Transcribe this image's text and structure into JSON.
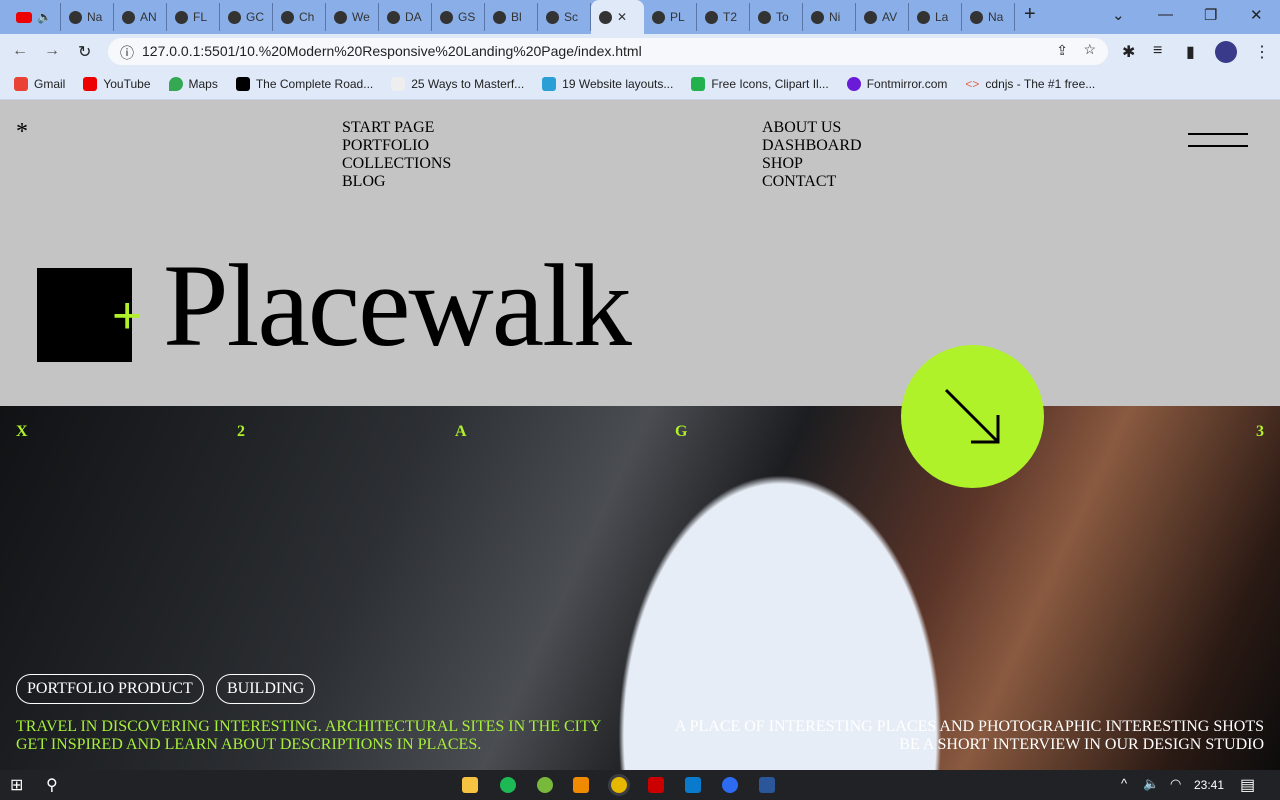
{
  "browser": {
    "tabs": [
      "",
      "Na",
      "AN",
      "FL",
      "GC",
      "Ch",
      "We",
      "DA",
      "GS",
      "Bl",
      "Sc",
      "",
      "PL",
      "T2",
      "To",
      "Ni",
      "AV",
      "La",
      "Na"
    ],
    "url": "127.0.0.1:5501/10.%20Modern%20Responsive%20Landing%20Page/index.html",
    "bookmarks": [
      "Gmail",
      "YouTube",
      "Maps",
      "The Complete Road...",
      "25 Ways to Masterf...",
      "19 Website layouts...",
      "Free Icons, Clipart Il...",
      "Fontmirror.com",
      "cdnjs - The #1 free..."
    ]
  },
  "page": {
    "star": "*",
    "nav_left": [
      "START PAGE",
      "PORTFOLIO",
      "COLLECTIONS",
      "BLOG"
    ],
    "nav_right": [
      "ABOUT US",
      "DASHBOARD",
      "SHOP",
      "CONTACT"
    ],
    "brand": "Placewalk",
    "plus": "+",
    "accent": "#b0f22a",
    "letters": [
      "X",
      "2",
      "A",
      "G",
      "3"
    ],
    "arrow": "↘",
    "pills": [
      "PORTFOLIO PRODUCT",
      "BUILDING"
    ],
    "left_text": [
      "TRAVEL IN DISCOVERING INTERESTING. ARCHITECTURAL SITES IN THE CITY",
      "GET INSPIRED AND LEARN ABOUT DESCRIPTIONS IN PLACES."
    ],
    "right_text": [
      "A PLACE OF INTERESTING PLACES AND PHOTOGRAPHIC INTERESTING SHOTS",
      "BE A SHORT INTERVIEW IN OUR DESIGN STUDIO"
    ]
  },
  "taskbar": {
    "time": "23:41"
  }
}
